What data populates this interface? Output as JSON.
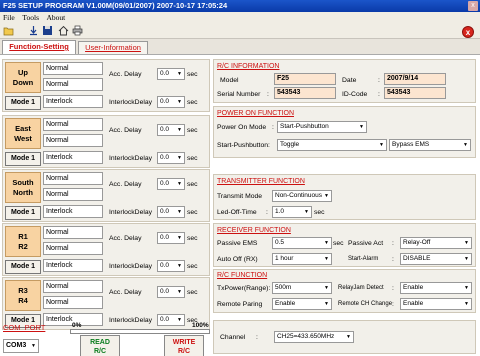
{
  "window": {
    "title": "F25 SETUP PROGRAM V1.00M(09/01/2007)  2007-10-17  17:05:24",
    "close_glyph": "x"
  },
  "menu": {
    "file": "File",
    "tools": "Tools",
    "about": "About"
  },
  "tabs": {
    "function_setting": "Function-Setting",
    "user_information": "User-Information"
  },
  "labels": {
    "acc_delay": "Acc. Delay",
    "interlock_delay": "InterlockDelay",
    "sec": "sec"
  },
  "groups": [
    {
      "name_line1": "Up",
      "name_line2": "Down",
      "mode": "Mode 1",
      "row1": "Normal",
      "row2": "Normal",
      "row3": "Interlock",
      "acc_delay": "0.0",
      "interlock_delay": "0.0"
    },
    {
      "name_line1": "East",
      "name_line2": "West",
      "mode": "Mode 1",
      "row1": "Normal",
      "row2": "Normal",
      "row3": "Interlock",
      "acc_delay": "0.0",
      "interlock_delay": "0.0"
    },
    {
      "name_line1": "South",
      "name_line2": "North",
      "mode": "Mode 1",
      "row1": "Normal",
      "row2": "Normal",
      "row3": "Interlock",
      "acc_delay": "0.0",
      "interlock_delay": "0.0"
    },
    {
      "name_line1": "R1",
      "name_line2": "R2",
      "mode": "Mode 1",
      "row1": "Normal",
      "row2": "Normal",
      "row3": "Interlock",
      "acc_delay": "0.0",
      "interlock_delay": "0.0"
    },
    {
      "name_line1": "R3",
      "name_line2": "R4",
      "mode": "Mode 1",
      "row1": "Normal",
      "row2": "Normal",
      "row3": "Interlock",
      "acc_delay": "0.0",
      "interlock_delay": "0.0"
    }
  ],
  "com": {
    "title": "COM_PORT",
    "port": "COM3",
    "progress_start": "0%",
    "progress_end": "100%",
    "progress_value": 0,
    "read_label1": "READ",
    "read_label2": "R/C",
    "write_label1": "WRITE",
    "write_label2": "R/C"
  },
  "rc_info": {
    "title": "R/C INFORMATION",
    "model_label": "Model",
    "model_value": "F25",
    "serial_label": "Serial Number",
    "serial_value": "543543",
    "date_label": "Date",
    "date_value": "2007/9/14",
    "id_label": "ID-Code",
    "id_value": "543543"
  },
  "power_on": {
    "title": "POWER ON FUNCTION",
    "mode_label": "Power On Mode",
    "mode_value": "Start-Pushbutton",
    "start_label": "Start-Pushbutton:",
    "start_value": "Toggle",
    "bypass_value": "Bypass EMS"
  },
  "transmitter": {
    "title": "TRANSMITTER FUNCTION",
    "mode_label": "Transmit Mode",
    "mode_value": "Non-Continuous",
    "led_label": "Led-Off-Time",
    "led_value": "1.0",
    "sec": "sec"
  },
  "receiver": {
    "title": "RECEIVER  FUNCTION",
    "passive_ems_label": "Passive EMS",
    "passive_ems_value": "0.5",
    "sec": "sec",
    "passive_act_label": "Passive Act",
    "passive_act_value": "Relay-Off",
    "auto_off_label": "Auto Off (RX)",
    "auto_off_value": "1 hour",
    "start_alarm_label": "Start-Alarm",
    "start_alarm_value": "DISABLE"
  },
  "rc_function": {
    "title": "R/C  FUNCTION",
    "tx_power_label": "TxPower(Range):",
    "tx_power_value": "500m",
    "relay_jam_label": "RelayJam Detect",
    "relay_jam_value": "Enable",
    "remote_paring_label": "Remote Paring",
    "remote_paring_value": "Enable",
    "remote_ch_label": "Remote CH Change",
    "remote_ch_value": "Enable"
  },
  "channel": {
    "label": "Channel",
    "value": "CH25=433.650MHz"
  }
}
